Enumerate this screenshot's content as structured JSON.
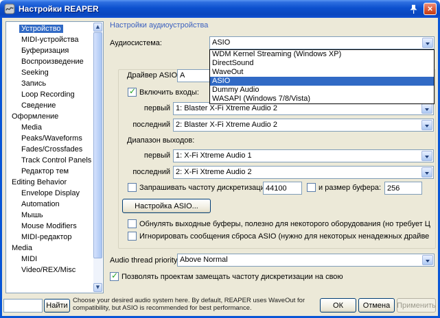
{
  "window": {
    "title": "Настройки REAPER"
  },
  "colors": {
    "selection": "#316AC5",
    "titlebar": "#0855D6",
    "section_header": "#3A5FBF",
    "check_green": "#21A121"
  },
  "sidebar": {
    "items": [
      {
        "label": "Устройство",
        "indent": 1,
        "selected": true
      },
      {
        "label": "MIDI-устройства",
        "indent": 1,
        "selected": false
      },
      {
        "label": "Буферизация",
        "indent": 1,
        "selected": false
      },
      {
        "label": "Воспроизведение",
        "indent": 1,
        "selected": false
      },
      {
        "label": "Seeking",
        "indent": 1,
        "selected": false
      },
      {
        "label": "Запись",
        "indent": 1,
        "selected": false
      },
      {
        "label": "Loop Recording",
        "indent": 1,
        "selected": false
      },
      {
        "label": "Сведение",
        "indent": 1,
        "selected": false
      },
      {
        "label": "Оформление",
        "indent": 0,
        "selected": false
      },
      {
        "label": "Media",
        "indent": 1,
        "selected": false
      },
      {
        "label": "Peaks/Waveforms",
        "indent": 1,
        "selected": false
      },
      {
        "label": "Fades/Crossfades",
        "indent": 1,
        "selected": false
      },
      {
        "label": "Track Control Panels",
        "indent": 1,
        "selected": false
      },
      {
        "label": "Редактор тем",
        "indent": 1,
        "selected": false
      },
      {
        "label": "Editing Behavior",
        "indent": 0,
        "selected": false
      },
      {
        "label": "Envelope Display",
        "indent": 1,
        "selected": false
      },
      {
        "label": "Automation",
        "indent": 1,
        "selected": false
      },
      {
        "label": "Мышь",
        "indent": 1,
        "selected": false
      },
      {
        "label": "Mouse Modifiers",
        "indent": 1,
        "selected": false
      },
      {
        "label": "MIDI-редактор",
        "indent": 1,
        "selected": false
      },
      {
        "label": "Media",
        "indent": 0,
        "selected": false
      },
      {
        "label": "MIDI",
        "indent": 1,
        "selected": false
      },
      {
        "label": "Video/REX/Misc",
        "indent": 1,
        "selected": false
      }
    ]
  },
  "main": {
    "section_title": "Настройки аудиоустройства",
    "audio_system": {
      "label": "Аудиосистема:",
      "value": "ASIO",
      "options": [
        "WDM Kernel Streaming (Windows XP)",
        "DirectSound",
        "WaveOut",
        "ASIO",
        "Dummy Audio",
        "WASAPI (Windows 7/8/Vista)"
      ],
      "selected_index": 3
    },
    "asio": {
      "driver_label": "Драйвер ASIO:",
      "driver_value_visible": "A",
      "enable_inputs_label": "Включить входы:",
      "enable_inputs_checked": true,
      "first_label": "первый",
      "last_label": "последний",
      "input_first_value": "1: Blaster X-Fi Xtreme Audio 2",
      "input_last_value": "2: Blaster X-Fi Xtreme Audio 2",
      "output_range_label": "Диапазон выходов:",
      "output_first_value": "1: X-Fi Xtreme Audio 1",
      "output_last_value": "2: X-Fi Xtreme Audio 2",
      "request_samplerate_label": "Запрашивать частоту дискретизации:",
      "request_samplerate_checked": false,
      "samplerate_value": "44100",
      "buffer_label": "и размер буфера:",
      "buffer_checked": false,
      "buffer_value": "256",
      "asio_config_button": "Настройка ASIO...",
      "zero_buffers_label": "Обнулять выходные буферы, полезно для некоторого оборудования (но требует Ц",
      "zero_buffers_checked": false,
      "ignore_reset_label": "Игнорировать сообщения сброса ASIO (нужно для некоторых ненадежных драйве",
      "ignore_reset_checked": false
    },
    "thread_priority": {
      "label": "Audio thread priority:",
      "value": "Above Normal"
    },
    "allow_override_label": "Позволять проектам замещать частоту дискретизации на свою",
    "allow_override_checked": true
  },
  "footer": {
    "search_value": "",
    "find_button": "Найти",
    "help_text": "Choose your desired audio system here. By default, REAPER uses WaveOut for compatibility, but ASIO is recommended for best performance.",
    "ok_button": "ОК",
    "cancel_button": "Отмена",
    "apply_button": "Применить"
  }
}
